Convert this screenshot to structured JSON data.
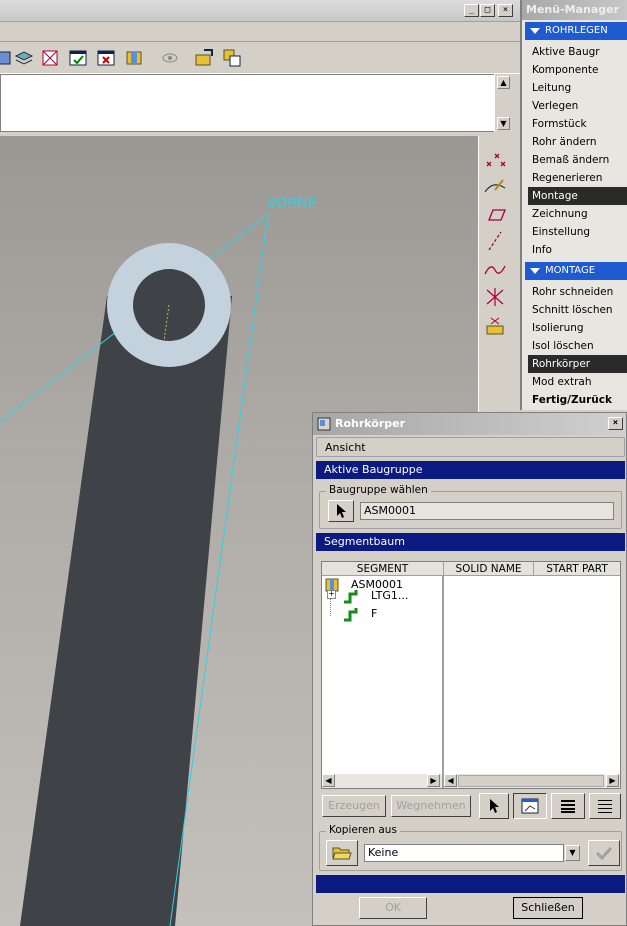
{
  "main_window": {
    "viewport": {
      "view_label": "VORNE"
    },
    "title_buttons": {
      "minimize": "_",
      "maximize": "□",
      "close": "×"
    }
  },
  "menu_manager": {
    "title": "Menü-Manager",
    "section1": {
      "label": "ROHRLEGEN",
      "items": [
        "Aktive Baugr",
        "Komponente",
        "Leitung",
        "Verlegen",
        "Formstück",
        "Rohr ändern",
        "Bemaß ändern",
        "Regenerieren",
        "Montage",
        "Zeichnung",
        "Einstellung",
        "Info"
      ],
      "selected": "Montage"
    },
    "section2": {
      "label": "MONTAGE",
      "items": [
        "Rohr schneiden",
        "Schnitt löschen",
        "Isolierung",
        "Isol löschen",
        "Rohrkörper",
        "Mod extrah",
        "Fertig/Zurück"
      ],
      "selected": "Rohrkörper"
    }
  },
  "dialog": {
    "title": "Rohrkörper",
    "menu": {
      "ansicht": "Ansicht"
    },
    "section_active": "Aktive Baugruppe",
    "group_select": {
      "label": "Baugruppe wählen",
      "value": "ASM0001"
    },
    "section_tree": "Segmentbaum",
    "tree": {
      "columns": [
        "SEGMENT",
        "SOLID NAME",
        "START PART"
      ],
      "root": "ASM0001",
      "children": [
        "LTG1...",
        "F"
      ]
    },
    "buttons": {
      "create": "Erzeugen",
      "remove": "Wegnehmen",
      "ok": "OK",
      "close": "Schließen"
    },
    "group_copy": {
      "label": "Kopieren aus",
      "value": "Keine"
    },
    "colors": {
      "section_bg": "#0a1a80",
      "menu_head": "#1e5bd0"
    }
  }
}
